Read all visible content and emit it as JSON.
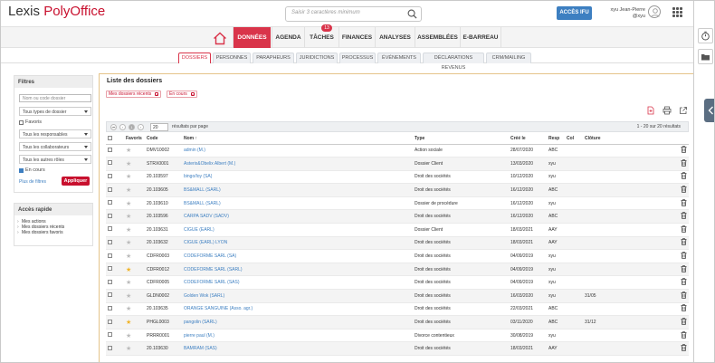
{
  "brand": {
    "part1": "Lexis ",
    "part2": "PolyOffice"
  },
  "header": {
    "search_placeholder": "Saisir 3 caractères minimum",
    "acces_label": "ACCÈS IFU",
    "user_name": "xyu Jean-Pierre",
    "user_id": "@xyu"
  },
  "menu": {
    "items": [
      {
        "label": "DONNÉES",
        "active": true
      },
      {
        "label": "AGENDA"
      },
      {
        "label": "TÂCHES",
        "badge": "13"
      },
      {
        "label": "FINANCES"
      },
      {
        "label": "ANALYSES"
      },
      {
        "label": "ASSEMBLÉES"
      },
      {
        "label": "E-BARREAU"
      }
    ]
  },
  "subtabs": [
    "DOSSIERS",
    "PERSONNES",
    "PARAPHEURS",
    "JURIDICTIONS",
    "PROCESSUS",
    "ÉVÉNEMENTS",
    "DÉCLARATIONS REVENUS",
    "CRM/MAILING"
  ],
  "filters": {
    "title": "Filtres",
    "name_placeholder": "Nom ou code dossier",
    "type_select": "Tous types de dossier",
    "favoris": "Favoris",
    "resp_select": "Tous les responsables",
    "collab_select": "Tous les collaborateurs",
    "roles_select": "Tous les autres rôles",
    "en_cours": "En cours",
    "more_filters": "Plus de filtres",
    "apply": "Appliquer"
  },
  "quick": {
    "title": "Accès rapide",
    "items": [
      "Mes actions",
      "Mes dossiers récents",
      "Mes dossiers favoris"
    ]
  },
  "list": {
    "title": "Liste des dossiers",
    "chips": [
      "Mes dossiers récents",
      "En cours"
    ],
    "page": "1",
    "per_page": "20",
    "per_page_label": "résultats par page",
    "count": "1 - 20 sur 20 résultats"
  },
  "columns": {
    "favoris": "Favoris",
    "code": "Code",
    "nom": "Nom ↑",
    "type": "Type",
    "cree": "Créé le",
    "resp": "Resp",
    "col": "Col",
    "cloture": "Clôture"
  },
  "rows": [
    {
      "code": "DMV10002",
      "nom": "admin (M.)",
      "type": "Action sociale",
      "cree": "28/07/2020",
      "resp": "ABC",
      "col": "",
      "cloture": "",
      "fav": false
    },
    {
      "code": "STRX0001",
      "nom": "Asterix&Obelix Albert (M.)",
      "type": "Dossier Client",
      "cree": "13/03/2020",
      "resp": "xyu",
      "col": "",
      "cloture": "",
      "fav": false
    },
    {
      "code": "20.103597",
      "nom": "bingo/loy (SA)",
      "type": "Droit des sociétés",
      "cree": "10/12/2020",
      "resp": "xyu",
      "col": "",
      "cloture": "",
      "fav": false
    },
    {
      "code": "20.103605",
      "nom": "BS&MALL (SARL)",
      "type": "Droit des sociétés",
      "cree": "16/12/2020",
      "resp": "ABC",
      "col": "",
      "cloture": "",
      "fav": false
    },
    {
      "code": "20.103610",
      "nom": "BS&MALL (SARL)",
      "type": "Dossier de procédure",
      "cree": "16/12/2020",
      "resp": "xyu",
      "col": "",
      "cloture": "",
      "fav": false
    },
    {
      "code": "20.103596",
      "nom": "CARPA SADV (SADV)",
      "type": "Droit des sociétés",
      "cree": "16/12/2020",
      "resp": "ABC",
      "col": "",
      "cloture": "",
      "fav": false
    },
    {
      "code": "20.103631",
      "nom": "CIGUE (EARL)",
      "type": "Dossier Client",
      "cree": "18/03/2021",
      "resp": "AAY",
      "col": "",
      "cloture": "",
      "fav": false
    },
    {
      "code": "20.103632",
      "nom": "CIGUE (EARL) LYON",
      "type": "Droit des sociétés",
      "cree": "18/03/2021",
      "resp": "AAY",
      "col": "",
      "cloture": "",
      "fav": false
    },
    {
      "code": "CDFR0003",
      "nom": "CODEFORME SARL (SA)",
      "type": "Droit des sociétés",
      "cree": "04/09/2019",
      "resp": "xyu",
      "col": "",
      "cloture": "",
      "fav": false
    },
    {
      "code": "CDFR0012",
      "nom": "CODEFORME SARL (SARL)",
      "type": "Droit des sociétés",
      "cree": "04/09/2019",
      "resp": "xyu",
      "col": "",
      "cloture": "",
      "fav": true
    },
    {
      "code": "CDFR0005",
      "nom": "CODEFORME SARL (SAS)",
      "type": "Droit des sociétés",
      "cree": "04/09/2019",
      "resp": "xyu",
      "col": "",
      "cloture": "",
      "fav": false
    },
    {
      "code": "GLDN0002",
      "nom": "Golden Wok (SARL)",
      "type": "Droit des sociétés",
      "cree": "16/03/2020",
      "resp": "xyu",
      "col": "",
      "cloture": "31/05",
      "fav": false
    },
    {
      "code": "20.103635",
      "nom": "ORANGE SANGUINE (Asso. agr.)",
      "type": "Droit des sociétés",
      "cree": "22/03/2021",
      "resp": "ABC",
      "col": "",
      "cloture": "",
      "fav": false
    },
    {
      "code": "PHGL0003",
      "nom": "pangolin (SARL)",
      "type": "Droit des sociétés",
      "cree": "03/11/2020",
      "resp": "ABC",
      "col": "",
      "cloture": "31/12",
      "fav": true
    },
    {
      "code": "PRRR0001",
      "nom": "pierre paul (M.)",
      "type": "Divorce contentieux",
      "cree": "30/08/2019",
      "resp": "xyu",
      "col": "",
      "cloture": "",
      "fav": false
    },
    {
      "code": "20.103630",
      "nom": "BAMRAM (SAS)",
      "type": "Droit des sociétés",
      "cree": "18/03/2021",
      "resp": "AAY",
      "col": "",
      "cloture": "",
      "fav": false
    }
  ]
}
